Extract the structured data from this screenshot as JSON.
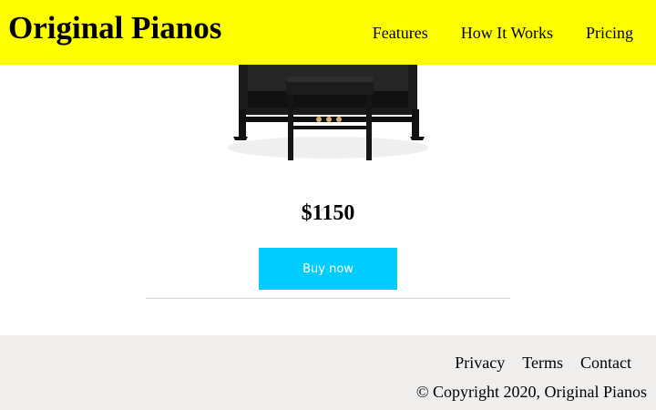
{
  "header": {
    "logo": "Original Pianos",
    "nav": [
      "Features",
      "How It Works",
      "Pricing"
    ]
  },
  "product": {
    "image_icon": "digital-piano-with-bench",
    "price": "$1150",
    "buy_label": "Buy now"
  },
  "footer": {
    "links": [
      "Privacy",
      "Terms",
      "Contact"
    ],
    "copyright": "© Copyright 2020, Original Pianos"
  },
  "colors": {
    "header_bg": "#ffff00",
    "button_bg": "#00ccff",
    "footer_bg": "#f0eeec"
  }
}
